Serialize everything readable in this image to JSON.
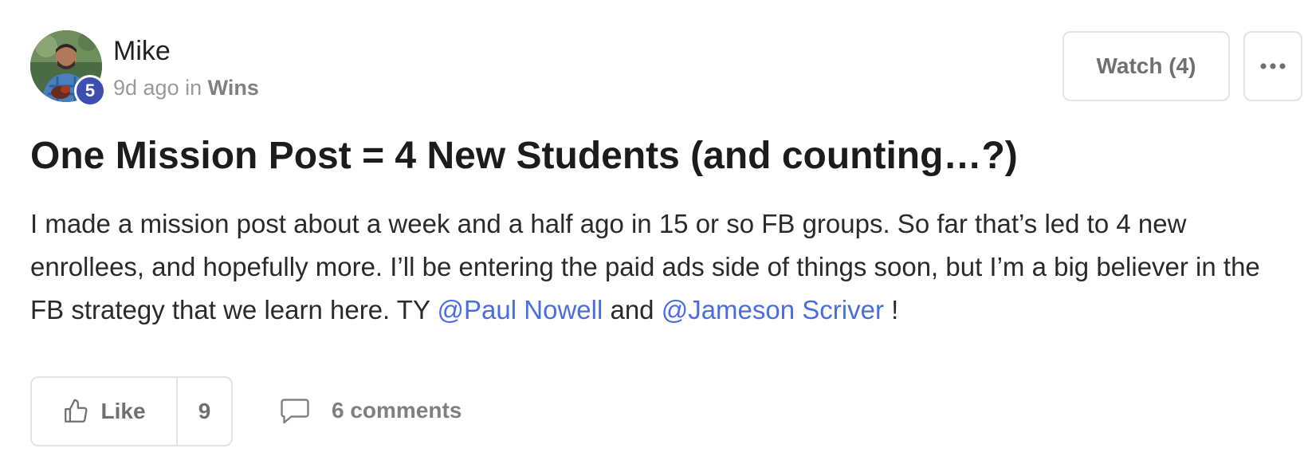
{
  "author": {
    "name": "Mike",
    "level": "5",
    "time_ago": "9d ago",
    "in_word": "in",
    "category": "Wins"
  },
  "actions": {
    "watch_label": "Watch (4)",
    "more_icon": "ellipsis-icon"
  },
  "post": {
    "title": "One Mission Post = 4 New Students (and counting…?)",
    "body_part1": "I made a mission post about a week and a half ago in 15 or so FB groups. So far that’s led to 4 new enrollees, and hopefully more. I’ll be entering the paid ads side of things soon, but I’m a big believer in the FB strategy that we learn here. TY ",
    "mention1": "@Paul Nowell",
    "body_and": " and ",
    "mention2": "@Jameson Scriver",
    "body_end": " !"
  },
  "footer": {
    "like_label": "Like",
    "like_count": "9",
    "comments_label": "6 comments",
    "like_icon": "thumbs-up-icon",
    "comment_icon": "comment-bubble-icon"
  },
  "colors": {
    "mention": "#4a6ee0",
    "level_badge": "#3c4fb0",
    "muted_text": "#9a9a9a",
    "border": "#e4e4e4"
  }
}
